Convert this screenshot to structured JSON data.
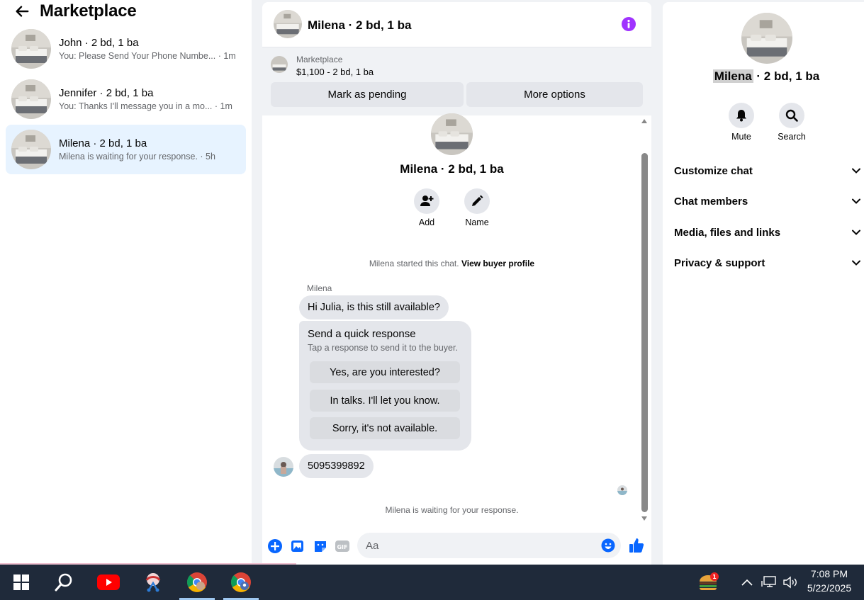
{
  "sidebar": {
    "title": "Marketplace",
    "conversations": [
      {
        "name": "John · 2 bd, 1 ba",
        "preview": "You: Please Send Your Phone Numbe... · 1m"
      },
      {
        "name": "Jennifer · 2 bd, 1 ba",
        "preview": "You: Thanks I'll message you in a mo... · 1m"
      },
      {
        "name": "Milena · 2 bd, 1 ba",
        "preview": "Milena is waiting for your response. · 5h"
      }
    ]
  },
  "chat": {
    "header_name": "Milena · 2 bd, 1 ba",
    "marketplace_label": "Marketplace",
    "listing": "$1,100 - 2 bd, 1 ba",
    "mark_pending": "Mark as pending",
    "more_options": "More options",
    "intro_name": "Milena · 2 bd, 1 ba",
    "add_label": "Add",
    "name_label": "Name",
    "started_text": "Milena started this chat.",
    "view_profile": "View buyer profile",
    "sender": "Milena",
    "message1": "Hi Julia, is this still available?",
    "quick_title": "Send a quick response",
    "quick_sub": "Tap a response to send it to the buyer.",
    "quick_options": [
      "Yes, are you interested?",
      "In talks. I'll let you know.",
      "Sorry, it's not available."
    ],
    "message2": "5095399892",
    "waiting": "Milena is waiting for your response.",
    "composer_placeholder": "Aa"
  },
  "right": {
    "name_highlight": "Milena",
    "name_rest": " · 2 bd, 1 ba",
    "mute_label": "Mute",
    "search_label": "Search",
    "sections": [
      "Customize chat",
      "Chat members",
      "Media, files and links",
      "Privacy & support"
    ]
  },
  "taskbar": {
    "time": "7:08 PM",
    "date": "5/22/2025",
    "notification_count": "1"
  },
  "colors": {
    "accent_blue": "#0866ff",
    "info_purple": "#a033ff",
    "active_row": "#e7f3ff",
    "taskbar": "#1f2a3a"
  }
}
